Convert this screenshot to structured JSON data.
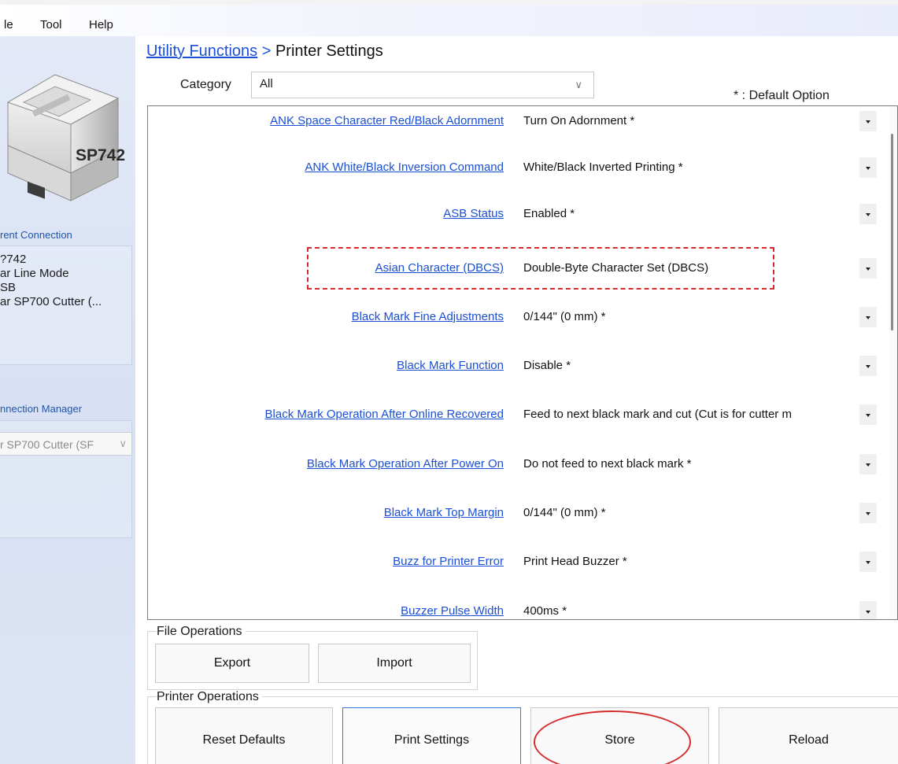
{
  "menu": [
    "le",
    "Tool",
    "Help"
  ],
  "left_panel": {
    "printer_model_label": "SP742",
    "current_connection_heading": "rent Connection",
    "connection_info": [
      "?742",
      "ar Line Mode",
      "SB",
      "ar SP700 Cutter (..."
    ],
    "connection_manager_heading": "nnection Manager",
    "connection_select_value": "r SP700 Cutter (SF"
  },
  "breadcrumb": {
    "parent": "Utility Functions",
    "separator": ">",
    "current": "Printer Settings"
  },
  "category": {
    "label": "Category",
    "value": "All"
  },
  "default_note": "* : Default Option",
  "settings": [
    {
      "label": "ANK Space Character Red/Black Adornment",
      "value": "Turn On Adornment *"
    },
    {
      "label": "ANK White/Black Inversion Command",
      "value": "White/Black Inverted Printing *"
    },
    {
      "label": "ASB Status",
      "value": "Enabled *"
    },
    {
      "label": "Asian Character (DBCS)",
      "value": "Double-Byte Character Set (DBCS)"
    },
    {
      "label": "Black Mark Fine Adjustments",
      "value": "0/144\" (0 mm) *"
    },
    {
      "label": "Black Mark Function",
      "value": "Disable *"
    },
    {
      "label": "Black Mark Operation After Online Recovered",
      "value": "Feed to next black mark and cut (Cut is for cutter m"
    },
    {
      "label": "Black Mark Operation After Power On",
      "value": "Do not feed to next black mark *"
    },
    {
      "label": "Black Mark Top Margin",
      "value": "0/144\"   (0 mm) *"
    },
    {
      "label": "Buzz for Printer Error",
      "value": "Print Head Buzzer *"
    },
    {
      "label": "Buzzer Pulse Width",
      "value": "400ms *"
    }
  ],
  "file_operations": {
    "title": "File Operations",
    "export_label": "Export",
    "import_label": "Import"
  },
  "printer_operations": {
    "title": "Printer Operations",
    "reset_label": "Reset Defaults",
    "print_settings_label": "Print Settings",
    "store_label": "Store",
    "reload_label": "Reload"
  },
  "colors": {
    "link": "#1a4fd6",
    "annotation": "#d62b2b",
    "panel": "#dde5f5"
  }
}
